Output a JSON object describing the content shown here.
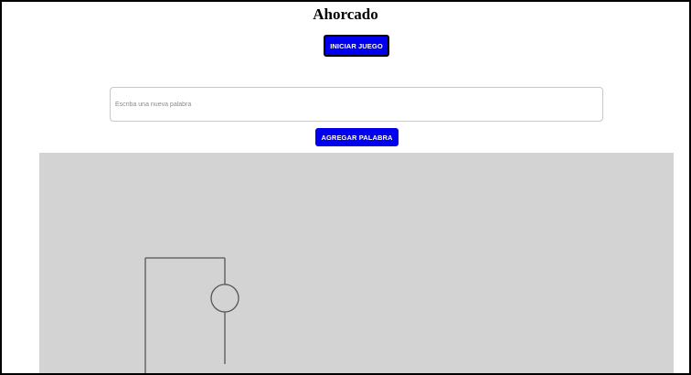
{
  "header": {
    "title": "Ahorcado"
  },
  "controls": {
    "start_label": "INICIAR JUEGO",
    "new_word_placeholder": "Escriba una nueva palabra",
    "new_word_value": "",
    "add_word_label": "AGREGAR PALABRA"
  },
  "colors": {
    "button_background": "#0000ee",
    "button_text": "#ffffff",
    "board_background": "#d3d3d3",
    "gallows_stroke": "#555555"
  },
  "board": {
    "gallows_parts_drawn": [
      "post",
      "beam",
      "rope",
      "head",
      "body"
    ]
  }
}
